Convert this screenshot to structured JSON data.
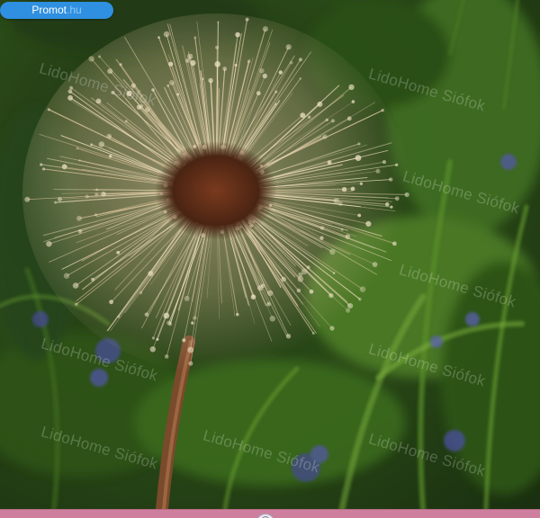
{
  "badge": {
    "site": "Promot",
    "tld": ".hu",
    "color": "#2f8fe0"
  },
  "watermarks": [
    "LidoHome Siófok",
    "LidoHome Siófok",
    "LidoHome Siófok",
    "LidoHome Siófok",
    "LidoHome Siófok",
    "LidoHome Siófok",
    "LidoHome Siófok",
    "LidoHome Siófok",
    "LidoHome Siófok"
  ],
  "photo": {
    "subject": "dandelion seed head"
  },
  "bottom_bar": {
    "color": "#cf7f9e"
  }
}
